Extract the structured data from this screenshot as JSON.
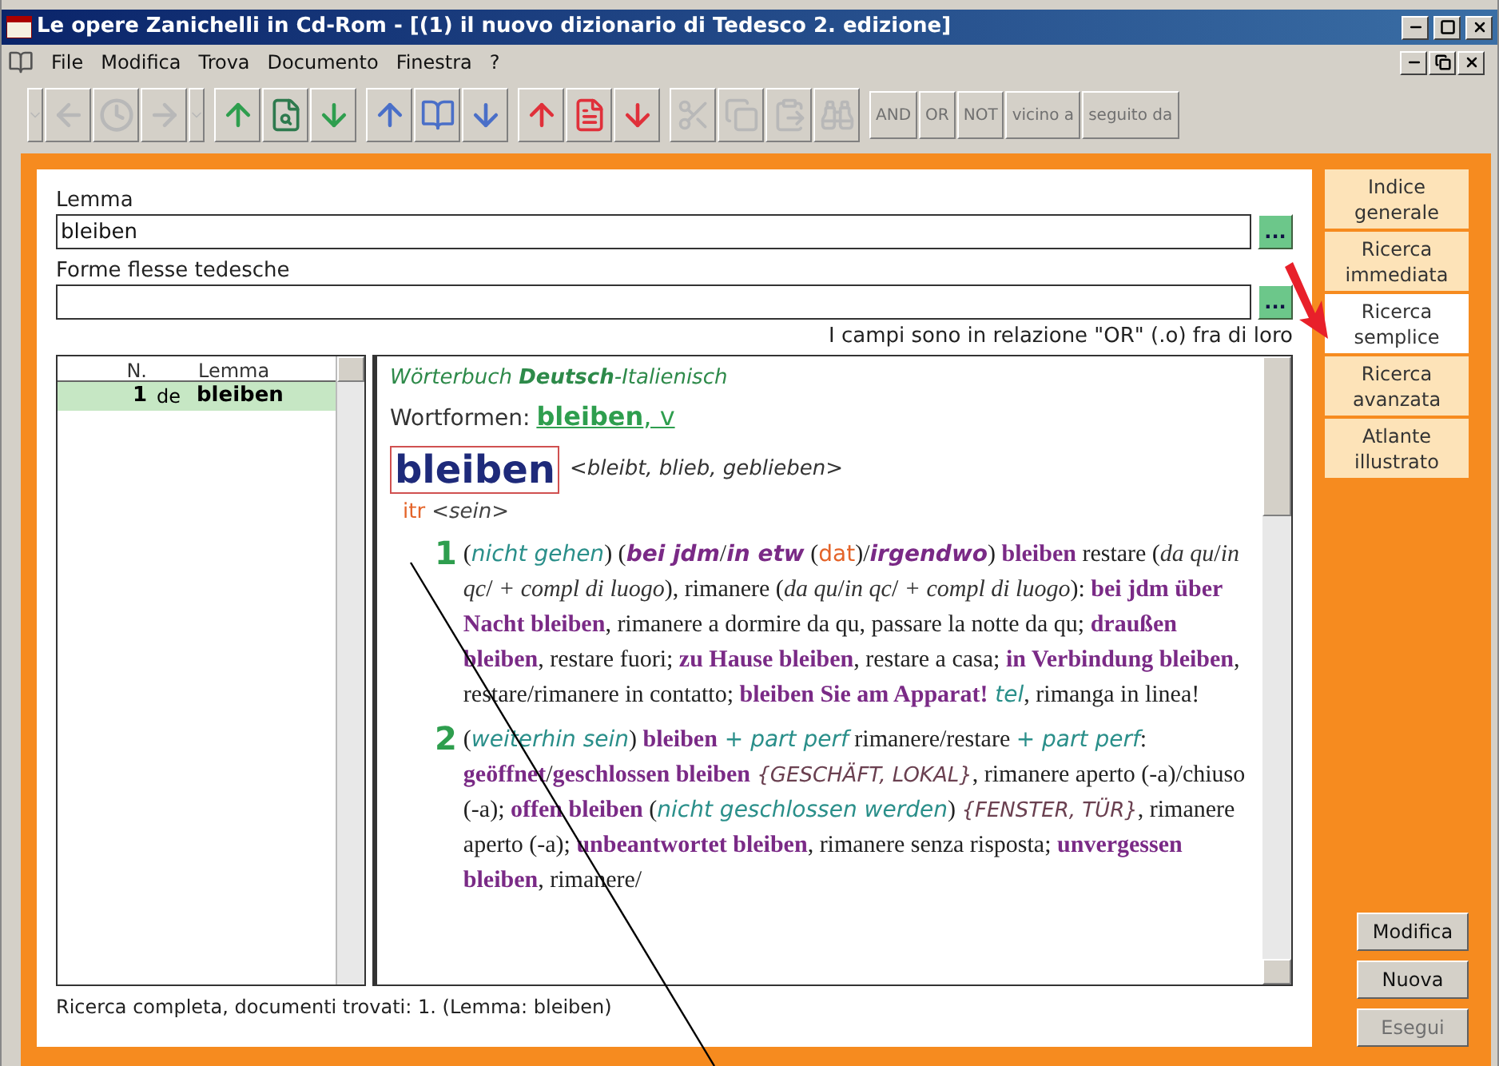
{
  "window": {
    "title": "Le opere Zanichelli in Cd-Rom - [(1) il nuovo dizionario di Tedesco 2. edizione]"
  },
  "menu": [
    "File",
    "Modifica",
    "Trova",
    "Documento",
    "Finestra",
    "?"
  ],
  "toolbar": [
    {
      "kind": "dropdown",
      "disabled": true
    },
    {
      "kind": "back",
      "disabled": true
    },
    {
      "kind": "history",
      "disabled": true
    },
    {
      "kind": "forward",
      "disabled": true
    },
    {
      "kind": "dropdown",
      "disabled": true
    },
    {
      "kind": "up",
      "color": "#2e9e4e",
      "disabled": false
    },
    {
      "kind": "find",
      "disabled": false
    },
    {
      "kind": "down",
      "color": "#2e9e4e",
      "disabled": false
    },
    {
      "kind": "up",
      "color": "#4a6fc8",
      "disabled": false
    },
    {
      "kind": "book",
      "disabled": false
    },
    {
      "kind": "down",
      "color": "#4a6fc8",
      "disabled": false
    },
    {
      "kind": "up",
      "color": "#e0303a",
      "disabled": false
    },
    {
      "kind": "document",
      "disabled": false
    },
    {
      "kind": "down",
      "color": "#e0303a",
      "disabled": false
    },
    {
      "kind": "cut",
      "disabled": true
    },
    {
      "kind": "copy",
      "disabled": true
    },
    {
      "kind": "paste",
      "disabled": true
    },
    {
      "kind": "binoculars",
      "disabled": true
    }
  ],
  "operators": [
    {
      "label": "AND",
      "disabled": true
    },
    {
      "label": "OR",
      "disabled": true
    },
    {
      "label": "NOT",
      "disabled": true
    },
    {
      "label": "vicino a",
      "disabled": true
    },
    {
      "label": "seguito da",
      "disabled": true
    }
  ],
  "form": {
    "fields": [
      {
        "label": "Lemma",
        "value": "bleiben",
        "button": "..."
      },
      {
        "label": "Forme flesse tedesche",
        "button": "..."
      }
    ],
    "hint": "I campi sono in relazione \"OR\" (.o) fra di loro"
  },
  "results": {
    "columns": [
      "N.",
      "Lemma"
    ],
    "rows": [
      {
        "n": "1",
        "lang": "de",
        "lemma": "bleiben",
        "selected": true
      }
    ]
  },
  "entry": {
    "source": "Wörterbuch **Deutsch**-Italienisch",
    "forms_label": "Wortformen:",
    "forms_link": "**bleiben**, v",
    "headword": "bleiben",
    "inflection": "<bleibt, blieb, geblieben>",
    "pos": "itr",
    "aux": "<sein>",
    "senses": [
      {
        "number": "1",
        "segments": [
          {
            "kind": "plain",
            "text": "("
          },
          {
            "kind": "gloss",
            "text": "nicht gehen"
          },
          {
            "kind": "plain",
            "text": ") ("
          },
          {
            "kind": "phrase",
            "text": "bei jdm"
          },
          {
            "kind": "plain",
            "text": "/"
          },
          {
            "kind": "phrase",
            "text": "in etw"
          },
          {
            "kind": "plain",
            "text": " ("
          },
          {
            "kind": "case",
            "text": "dat"
          },
          {
            "kind": "plain",
            "text": ")/"
          },
          {
            "kind": "phrase",
            "text": "irgendwo"
          },
          {
            "kind": "plain",
            "text": ") "
          },
          {
            "kind": "german",
            "text": "bleiben"
          },
          {
            "kind": "plain",
            "text": " restare ("
          },
          {
            "kind": "note",
            "text": "da qu"
          },
          {
            "kind": "plain",
            "text": "/"
          },
          {
            "kind": "note",
            "text": "in qc"
          },
          {
            "kind": "plain",
            "text": "/ "
          },
          {
            "kind": "note",
            "text": "+ compl di luogo"
          },
          {
            "kind": "plain",
            "text": "), rimanere ("
          },
          {
            "kind": "note",
            "text": "da qu"
          },
          {
            "kind": "plain",
            "text": "/"
          },
          {
            "kind": "note",
            "text": "in qc"
          },
          {
            "kind": "plain",
            "text": "/ "
          },
          {
            "kind": "note",
            "text": "+ compl di luogo"
          },
          {
            "kind": "plain",
            "text": "): "
          },
          {
            "kind": "german",
            "text": "bei jdm über Nacht bleiben"
          },
          {
            "kind": "plain",
            "text": ", rimanere a dormire da qu, passare la notte da qu; "
          },
          {
            "kind": "german",
            "text": "draußen bleiben"
          },
          {
            "kind": "plain",
            "text": ", restare fuori; "
          },
          {
            "kind": "german",
            "text": "zu Hause bleiben"
          },
          {
            "kind": "plain",
            "text": ", restare a casa; "
          },
          {
            "kind": "german",
            "text": "in Verbindung bleiben"
          },
          {
            "kind": "plain",
            "text": ", restare/rimanere in contatto; "
          },
          {
            "kind": "german",
            "text": "bleiben Sie am Apparat!"
          },
          {
            "kind": "gloss",
            "text": " tel"
          },
          {
            "kind": "plain",
            "text": ", rimanga in linea!"
          }
        ]
      },
      {
        "number": "2",
        "segments": [
          {
            "kind": "plain",
            "text": "("
          },
          {
            "kind": "gloss",
            "text": "weiterhin sein"
          },
          {
            "kind": "plain",
            "text": ") "
          },
          {
            "kind": "german",
            "text": "bleiben"
          },
          {
            "kind": "gloss",
            "text": " + part perf"
          },
          {
            "kind": "plain",
            "text": " rimanere/restare "
          },
          {
            "kind": "gloss",
            "text": "+ part perf"
          },
          {
            "kind": "plain",
            "text": ": "
          },
          {
            "kind": "german",
            "text": "geöffnet"
          },
          {
            "kind": "plain",
            "text": "/"
          },
          {
            "kind": "german",
            "text": "geschlossen bleiben"
          },
          {
            "kind": "domain",
            "text": " {GESCHÄFT, LOKAL}"
          },
          {
            "kind": "plain",
            "text": ", rimanere aperto (-a)/chiuso (-a); "
          },
          {
            "kind": "german",
            "text": "offen bleiben"
          },
          {
            "kind": "plain",
            "text": " ("
          },
          {
            "kind": "gloss",
            "text": "nicht geschlossen werden"
          },
          {
            "kind": "plain",
            "text": ") "
          },
          {
            "kind": "domain",
            "text": "{FENSTER, TÜR}"
          },
          {
            "kind": "plain",
            "text": ", rimanere aperto (-a); "
          },
          {
            "kind": "german",
            "text": "unbeantwortet bleiben"
          },
          {
            "kind": "plain",
            "text": ", rimanere senza risposta; "
          },
          {
            "kind": "german",
            "text": "unvergessen bleiben"
          },
          {
            "kind": "plain",
            "text": ", rimanere/"
          }
        ]
      }
    ]
  },
  "status": "Ricerca completa, documenti trovati: 1. (Lemma: bleiben)",
  "tabs": [
    {
      "lines": [
        "Indice",
        "generale"
      ],
      "selected": false
    },
    {
      "lines": [
        "Ricerca",
        "immediata"
      ],
      "selected": false
    },
    {
      "lines": [
        "Ricerca",
        "semplice"
      ],
      "selected": true
    },
    {
      "lines": [
        "Ricerca",
        "avanzata"
      ],
      "selected": false
    },
    {
      "lines": [
        "Atlante",
        "illustrato"
      ],
      "selected": false
    }
  ],
  "actions": [
    {
      "label": "Modifica",
      "disabled": false
    },
    {
      "label": "Nuova",
      "disabled": false
    },
    {
      "label": "Esegui",
      "disabled": true
    }
  ]
}
